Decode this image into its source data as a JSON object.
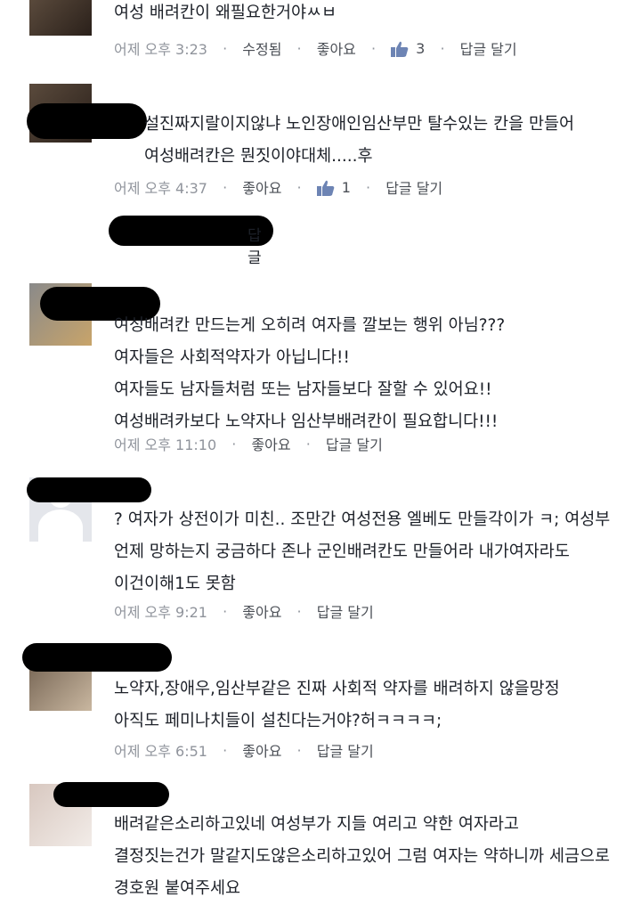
{
  "comments": [
    {
      "text": "여성 배려칸이 왜필요한거야ㅆㅂ",
      "time": "어제 오후 3:23",
      "edited": "수정됨",
      "like": "좋아요",
      "like_count": "3",
      "reply": "답글 달기"
    },
    {
      "text": "설진짜지랄이지않냐 노인장애인임산부만 탈수있는 칸을 만들어\n여성배려칸은 뭔짓이야대체.....후",
      "time": "어제 오후 4:37",
      "like": "좋아요",
      "like_count": "1",
      "reply": "답글 달기",
      "reply_summary": "답글"
    },
    {
      "text": "여성배려칸 만드는게 오히려 여자를 깔보는 행위 아님???\n여자들은 사회적약자가 아닙니다!!\n여자들도 남자들처럼 또는 남자들보다 잘할 수 있어요!!\n여성배려카보다 노약자나 임산부배려칸이 필요합니다!!!",
      "time": "어제 오후 11:10",
      "like": "좋아요",
      "reply": "답글 달기"
    },
    {
      "text": "? 여자가 상전이가 미친.. 조만간 여성전용 엘베도 만들각이가 ㅋ; 여성부\n언제 망하는지 궁금하다 존나 군인배려칸도 만들어라 내가여자라도\n이건이해1도 못함",
      "time": "어제 오후 9:21",
      "like": "좋아요",
      "reply": "답글 달기"
    },
    {
      "text": "노약자,장애우,임산부같은 진짜 사회적 약자를 배려하지 않을망정\n아직도 페미나치들이 설친다는거야?허ㅋㅋㅋㅋ;",
      "time": "어제 오후 6:51",
      "like": "좋아요",
      "reply": "답글 달기"
    },
    {
      "text": "배려같은소리하고있네 여성부가 지들 여리고 약한 여자라고\n결정짓는건가 말같지도않은소리하고있어 그럼 여자는 약하니까 세금으로\n경호원 붙여주세요"
    }
  ],
  "separator": "·"
}
